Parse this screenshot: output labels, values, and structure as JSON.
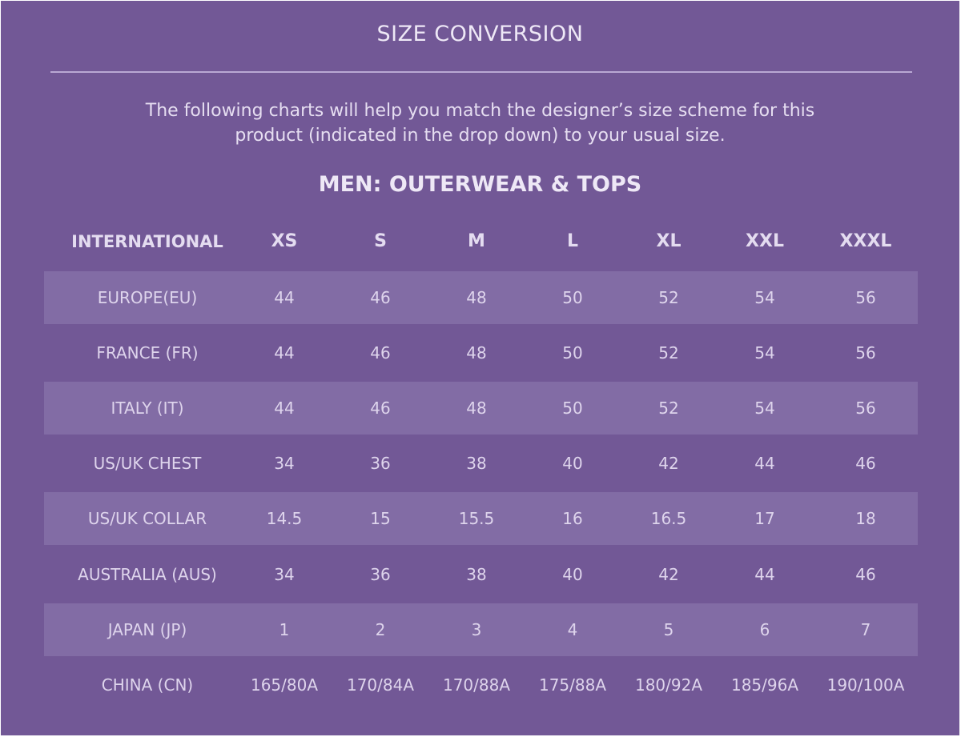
{
  "title": "SIZE CONVERSION",
  "intro": {
    "line1": "The following charts will help you match the designer’s size scheme for this",
    "line2": "product (indicated in the drop down) to your usual size."
  },
  "section_title": "MEN: OUTERWEAR & TOPS",
  "table": {
    "headers": [
      "INTERNATIONAL",
      "XS",
      "S",
      "M",
      "L",
      "XL",
      "XXL",
      "XXXL"
    ],
    "rows": [
      {
        "label": "EUROPE(EU)",
        "values": [
          "44",
          "46",
          "48",
          "50",
          "52",
          "54",
          "56"
        ],
        "shaded": true
      },
      {
        "label": "FRANCE (FR)",
        "values": [
          "44",
          "46",
          "48",
          "50",
          "52",
          "54",
          "56"
        ],
        "shaded": false
      },
      {
        "label": "ITALY (IT)",
        "values": [
          "44",
          "46",
          "48",
          "50",
          "52",
          "54",
          "56"
        ],
        "shaded": true
      },
      {
        "label": "US/UK CHEST",
        "values": [
          "34",
          "36",
          "38",
          "40",
          "42",
          "44",
          "46"
        ],
        "shaded": false
      },
      {
        "label": "US/UK COLLAR",
        "values": [
          "14.5",
          "15",
          "15.5",
          "16",
          "16.5",
          "17",
          "18"
        ],
        "shaded": true
      },
      {
        "label": "AUSTRALIA (AUS)",
        "values": [
          "34",
          "36",
          "38",
          "40",
          "42",
          "44",
          "46"
        ],
        "shaded": false
      },
      {
        "label": "JAPAN (JP)",
        "values": [
          "1",
          "2",
          "3",
          "4",
          "5",
          "6",
          "7"
        ],
        "shaded": true
      },
      {
        "label": "CHINA (CN)",
        "values": [
          "165/80A",
          "170/84A",
          "170/88A",
          "175/88A",
          "180/92A",
          "185/96A",
          "190/100A"
        ],
        "shaded": false
      }
    ]
  },
  "colors": {
    "background": "#725896",
    "row_shade": "#826ca5",
    "text": "#ece6f4"
  }
}
